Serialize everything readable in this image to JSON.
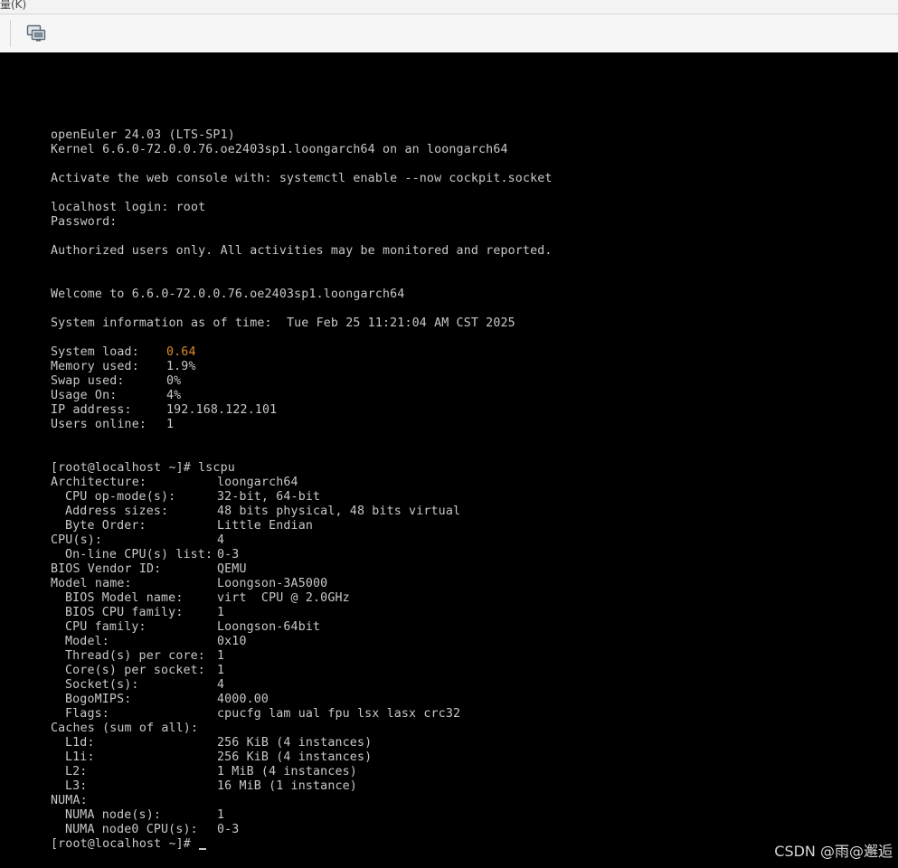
{
  "menu": {
    "fragment": "量(K)"
  },
  "toolbar": {
    "icon": "display-console-icon"
  },
  "console": {
    "banner": {
      "os": "openEuler 24.03 (LTS-SP1)",
      "kernel": "Kernel 6.6.0-72.0.0.76.oe2403sp1.loongarch64 on an loongarch64",
      "cockpit": "Activate the web console with: systemctl enable --now cockpit.socket",
      "login": "localhost login: root",
      "password": "Password:",
      "authorized": "Authorized users only. All activities may be monitored and reported.",
      "welcome": "Welcome to 6.6.0-72.0.0.76.oe2403sp1.loongarch64",
      "sysinfo": "System information as of time:  Tue Feb 25 11:21:04 AM CST 2025"
    },
    "stats": [
      {
        "label": "System load:",
        "value": "0.64",
        "highlight": true
      },
      {
        "label": "Memory used:",
        "value": "1.9%"
      },
      {
        "label": "Swap used:",
        "value": "0%"
      },
      {
        "label": "Usage On:",
        "value": "4%"
      },
      {
        "label": "IP address:",
        "value": "192.168.122.101"
      },
      {
        "label": "Users online:",
        "value": "1"
      }
    ],
    "highlight_color": "#e08a2c",
    "command": "[root@localhost ~]# lscpu",
    "lscpu": [
      {
        "label": "Architecture:",
        "value": "loongarch64",
        "indent": false
      },
      {
        "label": "CPU op-mode(s):",
        "value": "32-bit, 64-bit",
        "indent": true
      },
      {
        "label": "Address sizes:",
        "value": "48 bits physical, 48 bits virtual",
        "indent": true
      },
      {
        "label": "Byte Order:",
        "value": "Little Endian",
        "indent": true
      },
      {
        "label": "CPU(s):",
        "value": "4",
        "indent": false
      },
      {
        "label": "On-line CPU(s) list:",
        "value": "0-3",
        "indent": true
      },
      {
        "label": "BIOS Vendor ID:",
        "value": "QEMU",
        "indent": false
      },
      {
        "label": "Model name:",
        "value": "Loongson-3A5000",
        "indent": false
      },
      {
        "label": "BIOS Model name:",
        "value": "virt  CPU @ 2.0GHz",
        "indent": true
      },
      {
        "label": "BIOS CPU family:",
        "value": "1",
        "indent": true
      },
      {
        "label": "CPU family:",
        "value": "Loongson-64bit",
        "indent": true
      },
      {
        "label": "Model:",
        "value": "0x10",
        "indent": true
      },
      {
        "label": "Thread(s) per core:",
        "value": "1",
        "indent": true
      },
      {
        "label": "Core(s) per socket:",
        "value": "1",
        "indent": true
      },
      {
        "label": "Socket(s):",
        "value": "4",
        "indent": true
      },
      {
        "label": "BogoMIPS:",
        "value": "4000.00",
        "indent": true
      },
      {
        "label": "Flags:",
        "value": "cpucfg lam ual fpu lsx lasx crc32",
        "indent": true
      },
      {
        "label": "Caches (sum of all):",
        "value": "",
        "indent": false
      },
      {
        "label": "L1d:",
        "value": "256 KiB (4 instances)",
        "indent": true
      },
      {
        "label": "L1i:",
        "value": "256 KiB (4 instances)",
        "indent": true
      },
      {
        "label": "L2:",
        "value": "1 MiB (4 instances)",
        "indent": true
      },
      {
        "label": "L3:",
        "value": "16 MiB (1 instance)",
        "indent": true
      },
      {
        "label": "NUMA:",
        "value": "",
        "indent": false
      },
      {
        "label": "NUMA node(s):",
        "value": "1",
        "indent": true
      },
      {
        "label": "NUMA node0 CPU(s):",
        "value": "0-3",
        "indent": true
      }
    ],
    "prompt": "[root@localhost ~]# "
  },
  "watermark": "CSDN @雨@邂逅"
}
